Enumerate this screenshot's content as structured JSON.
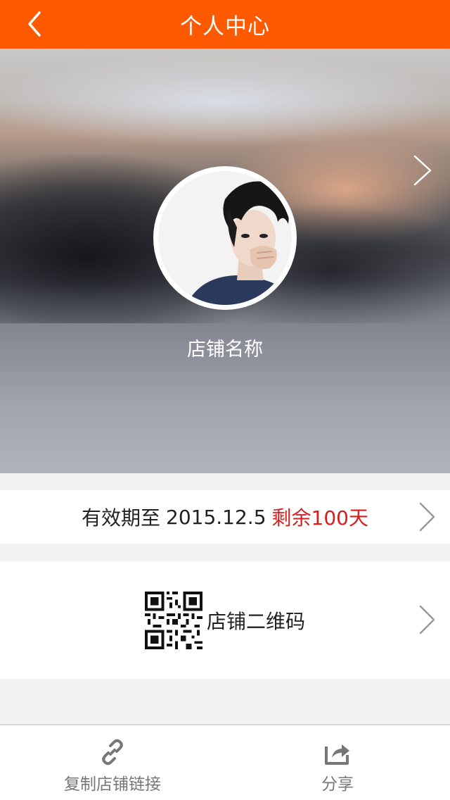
{
  "header": {
    "title": "个人中心",
    "back_icon": "chevron-left-icon"
  },
  "profile": {
    "store_name": "店铺名称",
    "next_icon": "chevron-right-icon"
  },
  "expiry": {
    "prefix": "有效期至",
    "date": "2015.12.5",
    "remaining": "剩余100天",
    "remaining_color": "#d81e1e"
  },
  "qr_row": {
    "label": "店铺二维码",
    "icon": "qr-code-icon"
  },
  "bottom_bar": {
    "copy_link": {
      "label": "复制店铺链接",
      "icon": "link-icon"
    },
    "share": {
      "label": "分享",
      "icon": "share-icon"
    }
  },
  "colors": {
    "accent": "#ff5a00",
    "text": "#222222",
    "muted": "#777777"
  }
}
